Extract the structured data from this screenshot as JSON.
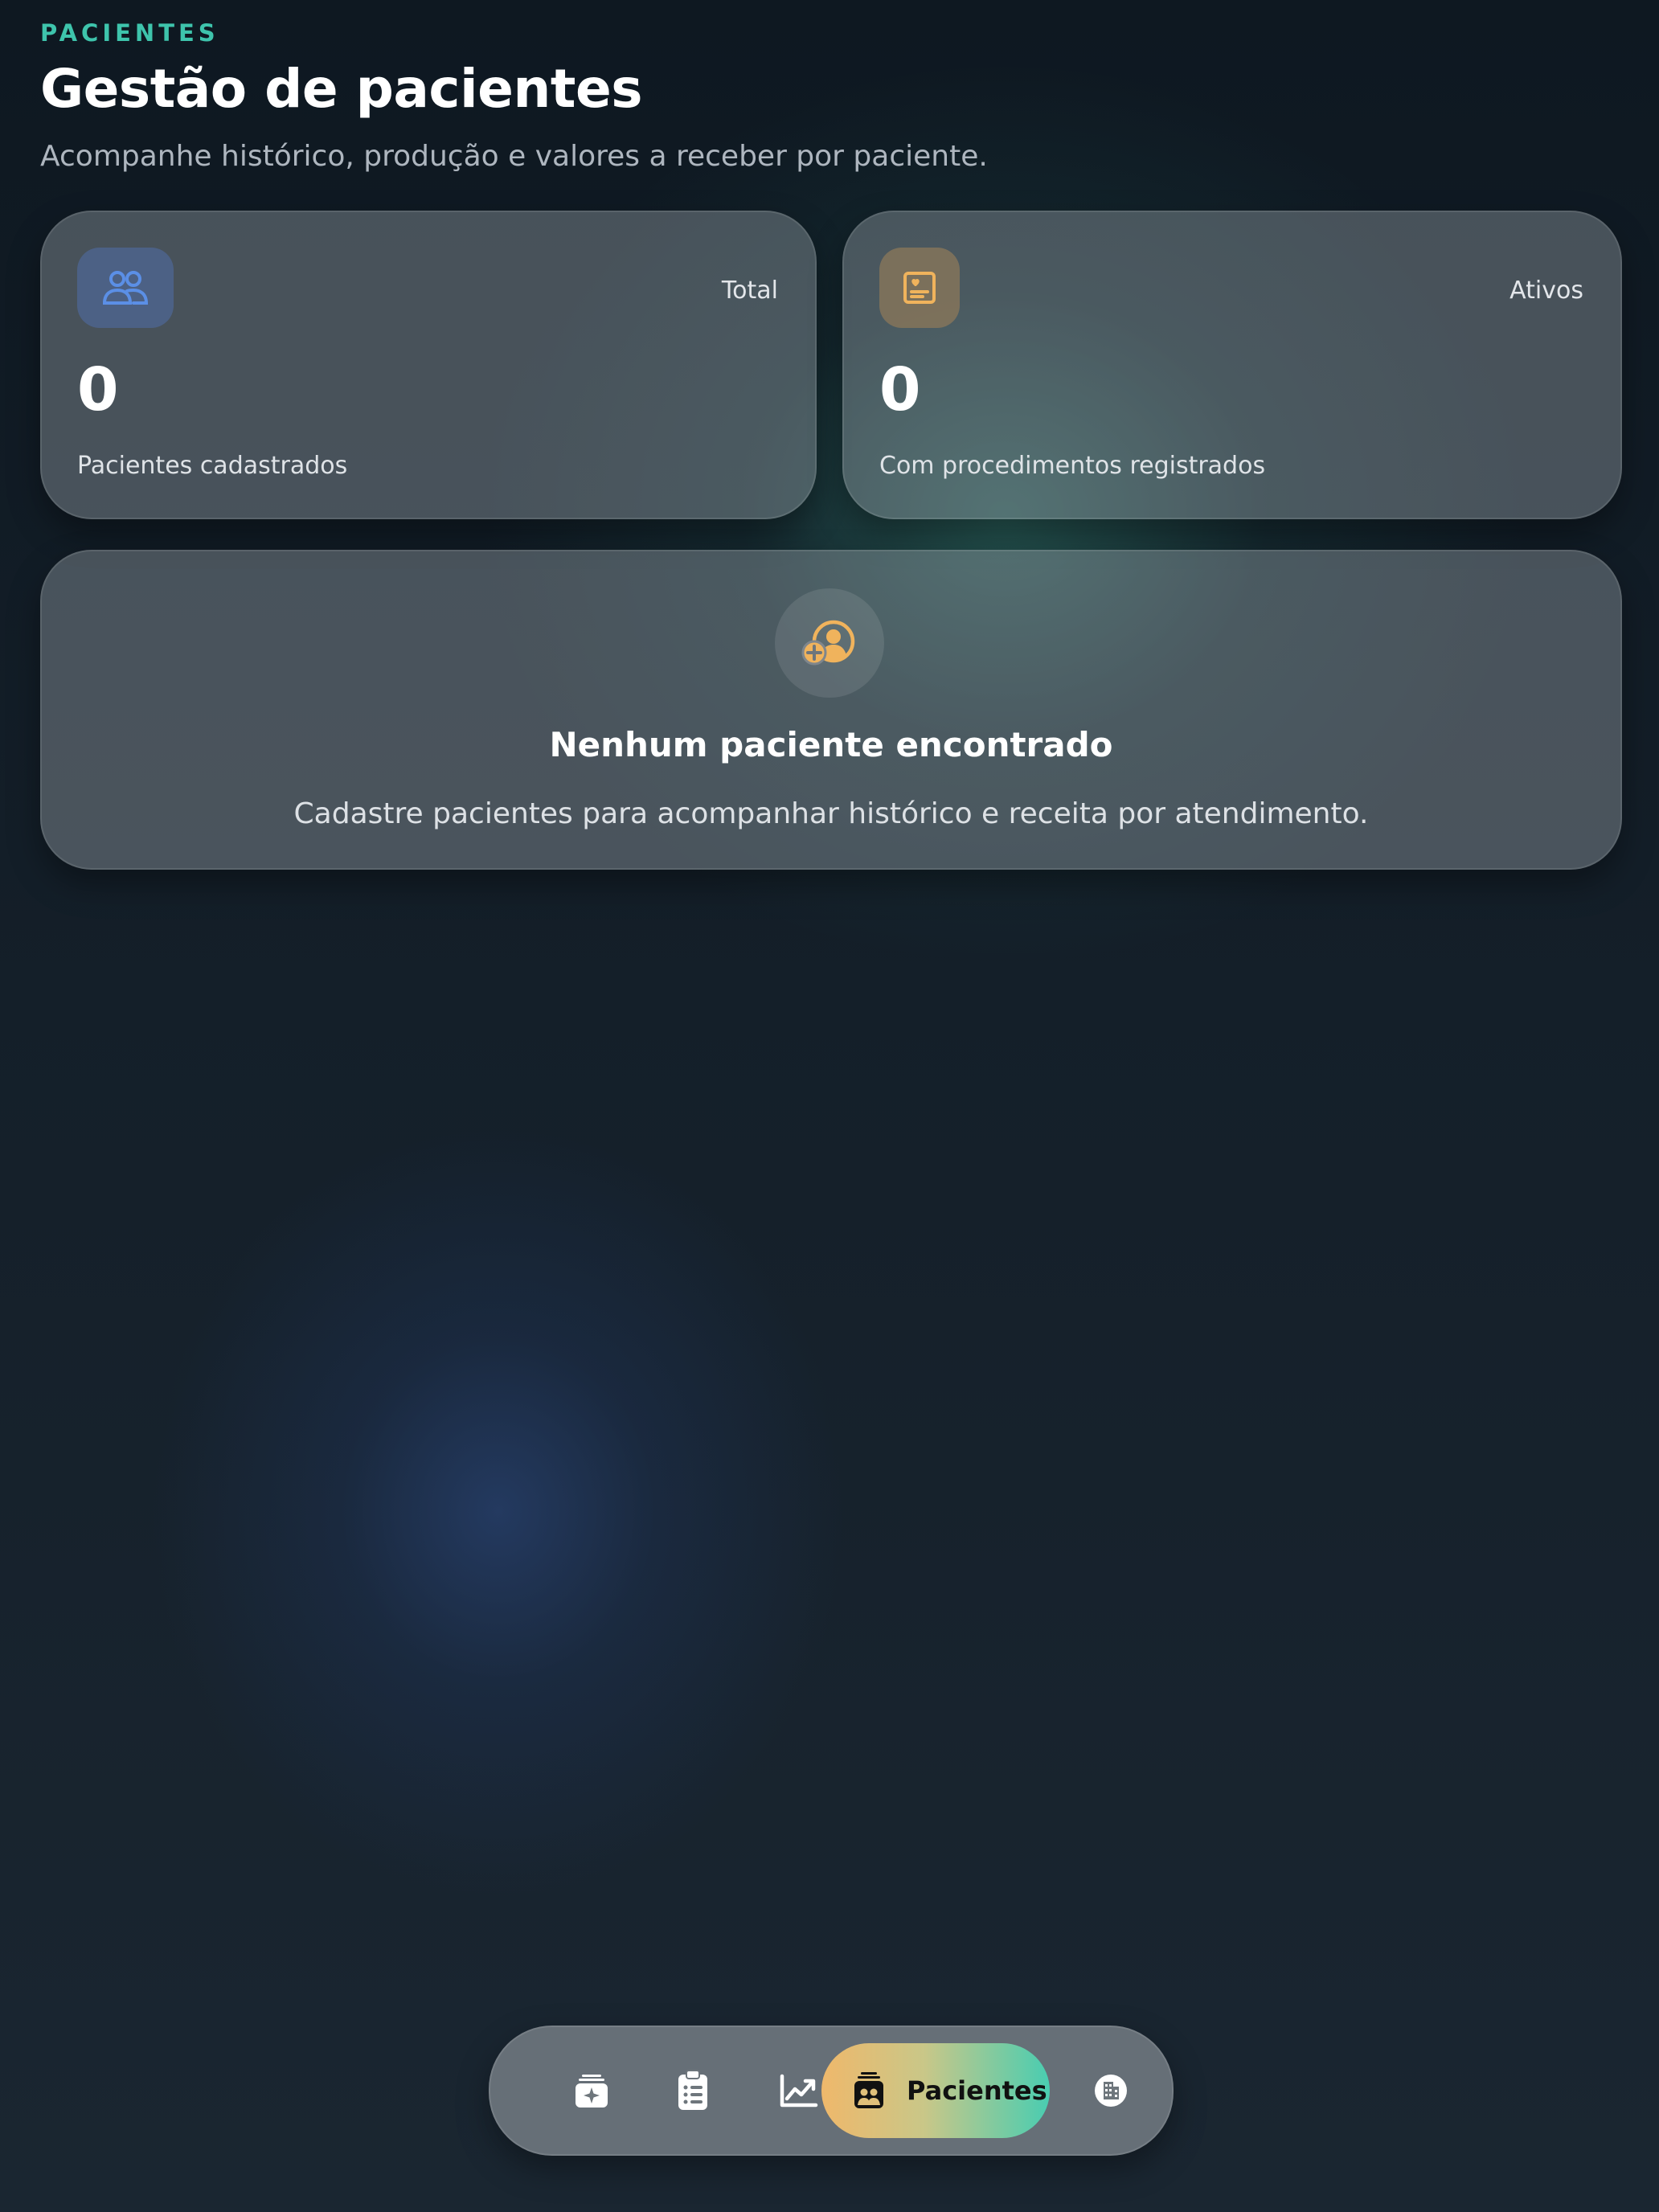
{
  "header": {
    "eyebrow": "PACIENTES",
    "title": "Gestão de pacientes",
    "subtitle": "Acompanhe histórico, produção e valores a receber por paciente."
  },
  "stats": [
    {
      "icon": "users-icon",
      "label": "Total",
      "value": "0",
      "description": "Pacientes cadastrados",
      "icon_color": "#5b8fe6"
    },
    {
      "icon": "medical-record-icon",
      "label": "Ativos",
      "value": "0",
      "description": "Com procedimentos registrados",
      "icon_color": "#f0b35c"
    }
  ],
  "empty_state": {
    "icon": "add-patient-icon",
    "title": "Nenhum paciente encontrado",
    "description": "Cadastre pacientes para acompanhar histórico e receita por atendimento."
  },
  "tabbar": {
    "items": [
      {
        "icon": "calendar-sparkle-icon"
      },
      {
        "icon": "clipboard-list-icon"
      },
      {
        "icon": "chart-trend-icon"
      },
      {
        "icon": "patients-icon",
        "label": "Pacientes",
        "active": true
      },
      {
        "icon": "building-icon"
      }
    ]
  },
  "colors": {
    "accent_teal": "#3ec4ac",
    "accent_amber": "#f0b35c",
    "accent_blue": "#5b8fe6"
  }
}
